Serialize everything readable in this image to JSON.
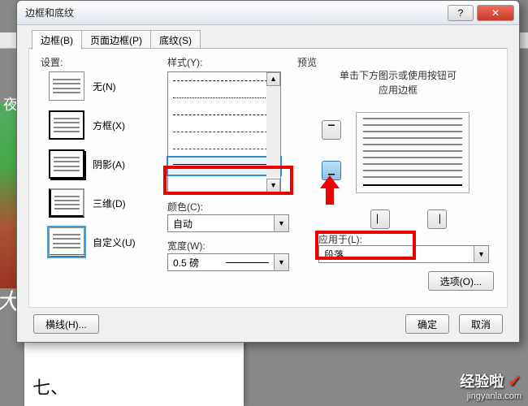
{
  "dialog": {
    "title": "边框和底纹",
    "help_symbol": "?",
    "close_symbol": "✕"
  },
  "tabs": {
    "border": "边框(B)",
    "pageborder": "页面边框(P)",
    "shading": "底纹(S)"
  },
  "settings": {
    "label": "设置:",
    "none": "无(N)",
    "box": "方框(X)",
    "shadow": "阴影(A)",
    "threeD": "三维(D)",
    "custom": "自定义(U)"
  },
  "style": {
    "label": "样式(Y):",
    "color_label": "颜色(C):",
    "color_value": "自动",
    "width_label": "宽度(W):",
    "width_value": "0.5 磅"
  },
  "preview": {
    "label": "预览",
    "hint_line1": "单击下方图示或使用按钮可",
    "hint_line2": "应用边框",
    "apply_label": "应用于(L):",
    "apply_value": "段落",
    "options": "选项(O)..."
  },
  "buttons": {
    "hline": "横线(H)...",
    "ok": "确定",
    "cancel": "取消"
  },
  "bg": {
    "sidetext": "夜大",
    "bigtext": "大",
    "bottomtext": "七、"
  },
  "watermark": {
    "brand": "经验啦",
    "url": "jingyanla.com",
    "check": "✓"
  }
}
